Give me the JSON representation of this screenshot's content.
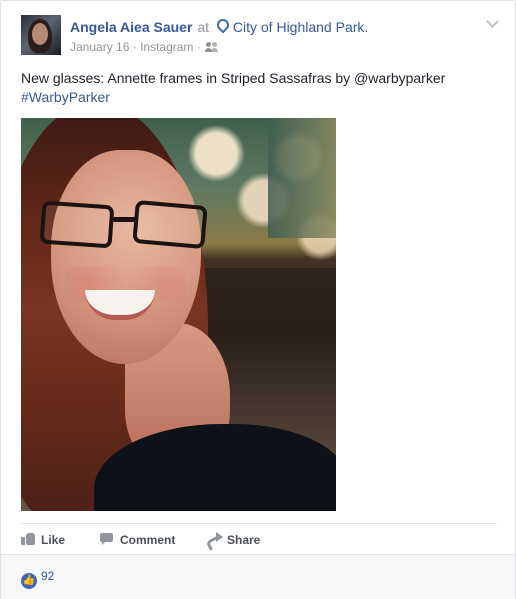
{
  "post": {
    "author": "Angela Aiea Sauer",
    "at_text": "at",
    "location": "City of Highland Park.",
    "date": "January 16",
    "separator_1": "·",
    "source": "Instagram",
    "separator_2": "·",
    "caption": "New glasses: Annette frames in Striped Sassafras by @warbyparker",
    "hashtag": "#WarbyParker"
  },
  "actions": {
    "like": "Like",
    "comment": "Comment",
    "share": "Share"
  },
  "reactions": {
    "count": "92",
    "icon": "👍"
  },
  "icons": {
    "location": "location-pin-icon",
    "privacy": "friends-icon",
    "menu": "chevron-down-icon"
  }
}
